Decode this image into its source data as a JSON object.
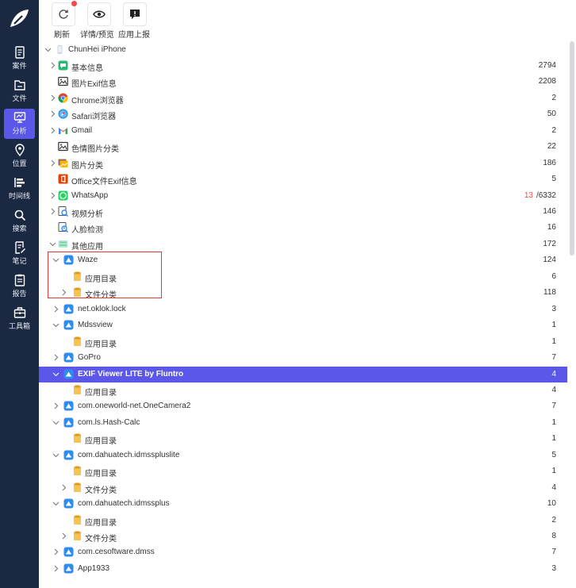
{
  "sidebar": {
    "items": [
      {
        "label": "案件",
        "icon": "case-icon"
      },
      {
        "label": "文件",
        "icon": "file-icon"
      },
      {
        "label": "分析",
        "icon": "analysis-icon",
        "active": true
      },
      {
        "label": "位置",
        "icon": "location-icon"
      },
      {
        "label": "时间线",
        "icon": "timeline-icon"
      },
      {
        "label": "搜索",
        "icon": "search-icon"
      },
      {
        "label": "笔记",
        "icon": "note-icon"
      },
      {
        "label": "报告",
        "icon": "report-icon"
      },
      {
        "label": "工具箱",
        "icon": "toolbox-icon"
      }
    ]
  },
  "toolbar": {
    "refresh_label": "刷新",
    "details_label": "详情/预览",
    "report_label": "应用上报"
  },
  "tree": {
    "rows": [
      {
        "label": "ChunHei iPhone",
        "count": "",
        "level": 0,
        "expand": "down",
        "icon": "device-icon"
      },
      {
        "label": "基本信息",
        "count": "2794",
        "level": 1,
        "expand": "right",
        "icon": "info-icon"
      },
      {
        "label": "图片Exif信息",
        "count": "2208",
        "level": 1,
        "expand": "none",
        "icon": "image-icon"
      },
      {
        "label": "Chrome浏览器",
        "count": "2",
        "level": 1,
        "expand": "right",
        "icon": "chrome-icon"
      },
      {
        "label": "Safari浏览器",
        "count": "50",
        "level": 1,
        "expand": "right",
        "icon": "safari-icon"
      },
      {
        "label": "Gmail",
        "count": "2",
        "level": 1,
        "expand": "right",
        "icon": "gmail-icon"
      },
      {
        "label": "色情图片分类",
        "count": "22",
        "level": 1,
        "expand": "none",
        "icon": "image-icon"
      },
      {
        "label": "图片分类",
        "count": "186",
        "level": 1,
        "expand": "right",
        "icon": "photo-category-icon"
      },
      {
        "label": "Office文件Exif信息",
        "count": "5",
        "level": 1,
        "expand": "none",
        "icon": "office-icon"
      },
      {
        "label": "WhatsApp",
        "count": "/6332",
        "count_highlight": "13",
        "level": 1,
        "expand": "right",
        "icon": "whatsapp-icon"
      },
      {
        "label": "视频分析",
        "count": "146",
        "level": 1,
        "expand": "right",
        "icon": "video-analysis-icon"
      },
      {
        "label": "人脸检测",
        "count": "16",
        "level": 1,
        "expand": "none",
        "icon": "face-detection-icon"
      },
      {
        "label": "其他应用",
        "count": "172",
        "level": 1,
        "expand": "down",
        "icon": "other-apps-icon"
      },
      {
        "label": "Waze",
        "count": "124",
        "level": 2,
        "expand": "down",
        "icon": "app-icon"
      },
      {
        "label": "应用目录",
        "count": "6",
        "level": 3,
        "expand": "none",
        "icon": "folder-icon"
      },
      {
        "label": "文件分类",
        "count": "118",
        "level": 3,
        "expand": "right",
        "icon": "folder-icon"
      },
      {
        "label": "net.oklok.lock",
        "count": "3",
        "level": 2,
        "expand": "right",
        "icon": "app-icon"
      },
      {
        "label": "Mdssview",
        "count": "1",
        "level": 2,
        "expand": "down",
        "icon": "app-icon"
      },
      {
        "label": "应用目录",
        "count": "1",
        "level": 3,
        "expand": "none",
        "icon": "folder-icon"
      },
      {
        "label": "GoPro",
        "count": "7",
        "level": 2,
        "expand": "right",
        "icon": "app-icon"
      },
      {
        "label": "EXIF Viewer LITE by Fluntro",
        "count": "4",
        "level": 2,
        "expand": "down",
        "icon": "app-icon",
        "selected": true
      },
      {
        "label": "应用目录",
        "count": "4",
        "level": 3,
        "expand": "none",
        "icon": "folder-icon"
      },
      {
        "label": "com.oneworld-net.OneCamera2",
        "count": "7",
        "level": 2,
        "expand": "right",
        "icon": "app-icon"
      },
      {
        "label": "com.ls.Hash-Calc",
        "count": "1",
        "level": 2,
        "expand": "down",
        "icon": "app-icon"
      },
      {
        "label": "应用目录",
        "count": "1",
        "level": 3,
        "expand": "none",
        "icon": "folder-icon"
      },
      {
        "label": "com.dahuatech.idmsspluslite",
        "count": "5",
        "level": 2,
        "expand": "down",
        "icon": "app-icon"
      },
      {
        "label": "应用目录",
        "count": "1",
        "level": 3,
        "expand": "none",
        "icon": "folder-icon"
      },
      {
        "label": "文件分类",
        "count": "4",
        "level": 3,
        "expand": "right",
        "icon": "folder-icon"
      },
      {
        "label": "com.dahuatech.idmssplus",
        "count": "10",
        "level": 2,
        "expand": "down",
        "icon": "app-icon"
      },
      {
        "label": "应用目录",
        "count": "2",
        "level": 3,
        "expand": "none",
        "icon": "folder-icon"
      },
      {
        "label": "文件分类",
        "count": "8",
        "level": 3,
        "expand": "right",
        "icon": "folder-icon"
      },
      {
        "label": "com.cesoftware.dmss",
        "count": "7",
        "level": 2,
        "expand": "right",
        "icon": "app-icon"
      },
      {
        "label": "App1933",
        "count": "3",
        "level": 2,
        "expand": "right",
        "icon": "app-icon"
      }
    ]
  },
  "colors": {
    "sidebar_bg": "#1b2841",
    "accent": "#5b57e8",
    "highlight_red": "#f04a4a",
    "annotation_box": "#e53935"
  }
}
